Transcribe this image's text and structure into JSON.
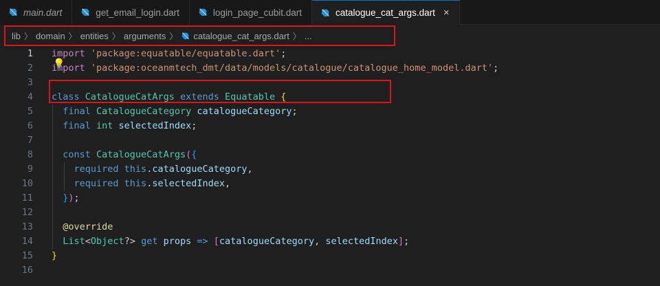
{
  "tabs": [
    {
      "label": "main.dart",
      "italic": true,
      "active": false
    },
    {
      "label": "get_email_login.dart",
      "italic": false,
      "active": false
    },
    {
      "label": "login_page_cubit.dart",
      "italic": false,
      "active": false
    },
    {
      "label": "catalogue_cat_args.dart",
      "italic": false,
      "active": true,
      "close": "×"
    }
  ],
  "breadcrumb": {
    "items": [
      "lib",
      "domain",
      "entities",
      "arguments"
    ],
    "file": "catalogue_cat_args.dart",
    "more": "..."
  },
  "editor": {
    "line_numbers": [
      "1",
      "2",
      "3",
      "4",
      "5",
      "6",
      "7",
      "8",
      "9",
      "10",
      "11",
      "12",
      "13",
      "14",
      "15",
      "16"
    ],
    "current_line": "1",
    "lines": [
      [
        {
          "t": "import ",
          "c": "kw2"
        },
        {
          "t": "'package:equatable/equatable.dart'",
          "c": "str"
        },
        {
          "t": ";",
          "c": "punc"
        }
      ],
      [
        {
          "t": "import ",
          "c": "kw2"
        },
        {
          "t": "'package:oceanmtech_dmt/data/models/catalogue/catalogue_home_model.dart'",
          "c": "str"
        },
        {
          "t": ";",
          "c": "punc"
        }
      ],
      [],
      [
        {
          "t": "class ",
          "c": "kw"
        },
        {
          "t": "CatalogueCatArgs ",
          "c": "type"
        },
        {
          "t": "extends ",
          "c": "kw"
        },
        {
          "t": "Equatable ",
          "c": "type"
        },
        {
          "t": "{",
          "c": "br1"
        }
      ],
      [
        {
          "t": "  final ",
          "c": "kw"
        },
        {
          "t": "CatalogueCategory ",
          "c": "type"
        },
        {
          "t": "catalogueCategory",
          "c": "var"
        },
        {
          "t": ";",
          "c": "punc"
        }
      ],
      [
        {
          "t": "  final ",
          "c": "kw"
        },
        {
          "t": "int ",
          "c": "type"
        },
        {
          "t": "selectedIndex",
          "c": "var"
        },
        {
          "t": ";",
          "c": "punc"
        }
      ],
      [],
      [
        {
          "t": "  const ",
          "c": "kw"
        },
        {
          "t": "CatalogueCatArgs",
          "c": "type"
        },
        {
          "t": "(",
          "c": "br2"
        },
        {
          "t": "{",
          "c": "br3"
        }
      ],
      [
        {
          "t": "    required ",
          "c": "kw"
        },
        {
          "t": "this",
          "c": "kw"
        },
        {
          "t": ".",
          "c": "punc"
        },
        {
          "t": "catalogueCategory",
          "c": "var"
        },
        {
          "t": ",",
          "c": "punc"
        }
      ],
      [
        {
          "t": "    required ",
          "c": "kw"
        },
        {
          "t": "this",
          "c": "kw"
        },
        {
          "t": ".",
          "c": "punc"
        },
        {
          "t": "selectedIndex",
          "c": "var"
        },
        {
          "t": ",",
          "c": "punc"
        }
      ],
      [
        {
          "t": "  ",
          "c": "punc"
        },
        {
          "t": "}",
          "c": "br3"
        },
        {
          "t": ")",
          "c": "br2"
        },
        {
          "t": ";",
          "c": "punc"
        }
      ],
      [],
      [
        {
          "t": "  @override",
          "c": "fn"
        }
      ],
      [
        {
          "t": "  List",
          "c": "type"
        },
        {
          "t": "<",
          "c": "punc"
        },
        {
          "t": "Object",
          "c": "type"
        },
        {
          "t": "?> ",
          "c": "punc"
        },
        {
          "t": "get ",
          "c": "kw"
        },
        {
          "t": "props ",
          "c": "var"
        },
        {
          "t": "=> ",
          "c": "kw"
        },
        {
          "t": "[",
          "c": "br2"
        },
        {
          "t": "catalogueCategory",
          "c": "var"
        },
        {
          "t": ", ",
          "c": "punc"
        },
        {
          "t": "selectedIndex",
          "c": "var"
        },
        {
          "t": "]",
          "c": "br2"
        },
        {
          "t": ";",
          "c": "punc"
        }
      ],
      [
        {
          "t": "}",
          "c": "br1"
        }
      ],
      []
    ]
  },
  "colors": {
    "highlight_box": "#e0121b",
    "active_tab_accent": "#0078d4",
    "dart_icon": "#2b8fd6"
  },
  "icons": {
    "tab_file": "dart-file-icon",
    "lightbulb": "lightbulb-icon",
    "close": "close-icon"
  }
}
